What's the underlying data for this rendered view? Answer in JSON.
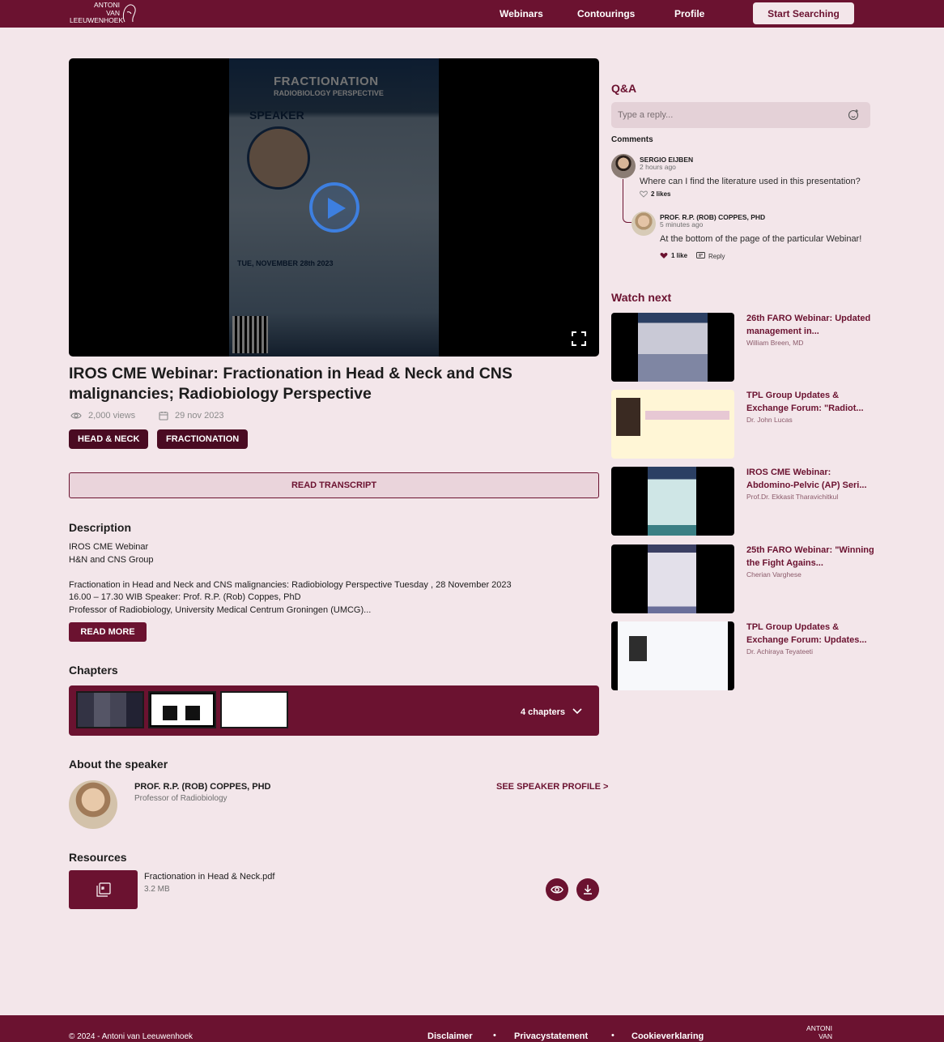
{
  "header": {
    "logo_line1": "ANTONI",
    "logo_line2": "VAN",
    "logo_line3": "LEEUWENHOEK",
    "nav": [
      "Webinars",
      "Contourings",
      "Profile"
    ],
    "cta": "Start Searching"
  },
  "video": {
    "poster_title": "FRACTIONATION",
    "poster_subtitle": "RADIOBIOLOGY PERSPECTIVE",
    "poster_speaker_label": "SPEAKER",
    "poster_date": "TUE, NOVEMBER 28th 2023"
  },
  "webinar": {
    "title": "IROS CME Webinar: Fractionation in Head & Neck and CNS malignancies; Radiobiology Perspective",
    "views": "2,000 views",
    "date": "29 nov 2023",
    "tags": [
      "HEAD & NECK",
      "FRACTIONATION"
    ],
    "transcript_label": "READ TRANSCRIPT"
  },
  "description": {
    "heading": "Description",
    "lines": [
      "IROS CME Webinar",
      "H&N and CNS Group",
      "",
      "Fractionation in Head and Neck and CNS malignancies: Radiobiology Perspective Tuesday , 28 November 2023",
      "16.00 – 17.30 WIB Speaker: Prof. R.P. (Rob) Coppes, PhD",
      "Professor of Radiobiology, University Medical Centrum Groningen (UMCG)..."
    ],
    "read_more": "READ MORE"
  },
  "chapters": {
    "heading": "Chapters",
    "count": "4 chapters"
  },
  "speaker": {
    "heading": "About the speaker",
    "name": "PROF. R.P. (ROB) COPPES, PHD",
    "role": "Professor of Radiobiology",
    "profile_link": "SEE SPEAKER PROFILE >"
  },
  "resources": {
    "heading": "Resources",
    "file_name": "Fractionation in Head & Neck.pdf",
    "file_size": "3.2 MB"
  },
  "qa": {
    "heading": "Q&A",
    "placeholder": "Type a reply...",
    "comments_heading": "Comments",
    "comments": [
      {
        "name": "SERGIO EIJBEN",
        "time": "2 hours ago",
        "text": "Where can I find the literature used in this presentation?",
        "likes": "2 likes"
      },
      {
        "name": "PROF. R.P. (ROB) COPPES, PHD",
        "time": "5 minutes ago",
        "text": "At the bottom of the page of the particular Webinar!",
        "likes": "1 like",
        "reply": "Reply"
      }
    ]
  },
  "watch_next": {
    "heading": "Watch next",
    "items": [
      {
        "title": "26th FARO Webinar: Updated management in...",
        "author": "William Breen, MD"
      },
      {
        "title": "TPL Group Updates & Exchange Forum: \"Radiot...",
        "author": "Dr. John Lucas"
      },
      {
        "title": "IROS CME Webinar: Abdomino-Pelvic (AP) Seri...",
        "author": "Prof.Dr. Ekkasit Tharavichitkul"
      },
      {
        "title": "25th FARO Webinar: \"Winning the Fight Agains...",
        "author": "Cherian Varghese"
      },
      {
        "title": "TPL Group Updates & Exchange Forum: Updates...",
        "author": "Dr. Achiraya Teyateeti"
      }
    ]
  },
  "footer": {
    "copyright": "© 2024 - Antoni van Leeuwenhoek",
    "links": [
      "Disclaimer",
      "Privacystatement",
      "Cookieverklaring"
    ],
    "logo_line1": "ANTONI",
    "logo_line2": "VAN"
  },
  "colors": {
    "brand": "#6b1230",
    "background": "#f3e6ea"
  }
}
